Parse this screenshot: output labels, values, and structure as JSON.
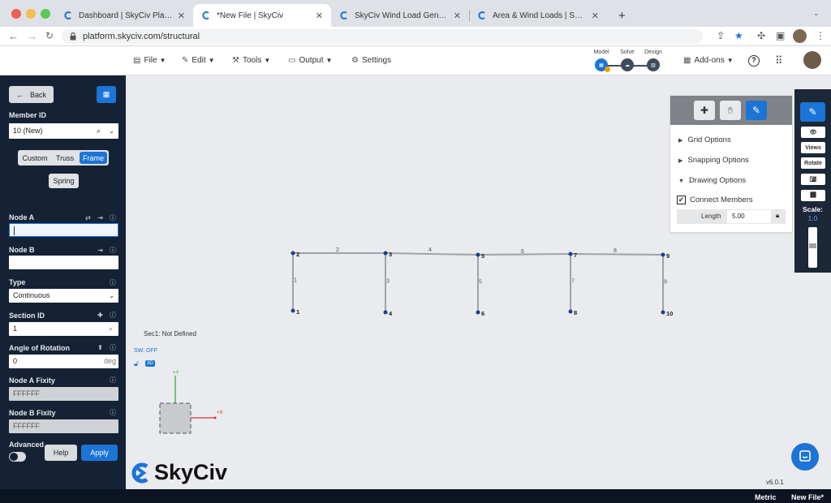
{
  "browser": {
    "tabs": [
      {
        "title": "Dashboard | SkyCiv Platform",
        "active": false
      },
      {
        "title": "*New File | SkyCiv",
        "active": true
      },
      {
        "title": "SkyCiv Wind Load Generator |",
        "active": false
      },
      {
        "title": "Area & Wind Loads | SkyCiv En",
        "active": false
      }
    ],
    "new_tab": "+",
    "url": "platform.skyciv.com/structural"
  },
  "menu": {
    "file": "File",
    "edit": "Edit",
    "tools": "Tools",
    "output": "Output",
    "settings": "Settings",
    "steps": [
      "Model",
      "Solve",
      "Design"
    ],
    "addons": "Add-ons"
  },
  "sidebar": {
    "back": "Back",
    "member_id_label": "Member ID",
    "member_id_value": "10 (New)",
    "types": [
      "Custom",
      "Truss",
      "Frame"
    ],
    "active_type": "Frame",
    "spring": "Spring",
    "node_a_label": "Node A",
    "node_a_value": "",
    "node_b_label": "Node B",
    "node_b_value": "",
    "type_label": "Type",
    "type_value": "Continuous",
    "section_label": "Section ID",
    "section_value": "1",
    "rotation_label": "Angle of Rotation",
    "rotation_value": "0",
    "rotation_unit": "deg",
    "fixity_a_label": "Node A Fixity",
    "fixity_a_value": "FFFFFF",
    "fixity_b_label": "Node B Fixity",
    "fixity_b_value": "FFFFFF",
    "advanced": "Advanced",
    "help": "Help",
    "apply": "Apply"
  },
  "canvas": {
    "sec_label": "Sec1: Not Defined",
    "sw": "SW: OFF",
    "badge": "3D",
    "axis_y": "+Y",
    "axis_x": "+X",
    "logo": "SkyCiv",
    "version": "v6.0.1",
    "nodes": [
      {
        "id": "1"
      },
      {
        "id": "2"
      },
      {
        "id": "3"
      },
      {
        "id": "4"
      },
      {
        "id": "5"
      },
      {
        "id": "6"
      },
      {
        "id": "7"
      },
      {
        "id": "8"
      },
      {
        "id": "9"
      },
      {
        "id": "10"
      }
    ],
    "members": [
      {
        "id": "1",
        "from": "1",
        "to": "2"
      },
      {
        "id": "2",
        "from": "2",
        "to": "3"
      },
      {
        "id": "3",
        "from": "4",
        "to": "3"
      },
      {
        "id": "4",
        "from": "3",
        "to": "5"
      },
      {
        "id": "5",
        "from": "6",
        "to": "5"
      },
      {
        "id": "6",
        "from": "5",
        "to": "7"
      },
      {
        "id": "7",
        "from": "8",
        "to": "7"
      },
      {
        "id": "8",
        "from": "7",
        "to": "9"
      },
      {
        "id": "9",
        "from": "10",
        "to": "9"
      }
    ]
  },
  "options_panel": {
    "grid": "Grid Options",
    "snapping": "Snapping Options",
    "drawing": "Drawing Options",
    "connect": "Connect Members",
    "length_label": "Length",
    "length_value": "5.00"
  },
  "right_toolbar": {
    "views": "Views",
    "rotate": "Rotate",
    "scale_label": "Scale:",
    "scale_value": "1.0"
  },
  "status": {
    "units": "Metric",
    "file": "New File*"
  },
  "colors": {
    "sidebar_bg": "#152235",
    "accent": "#1b74d6",
    "member": "#9ca3ab",
    "node": "#1f3c8f"
  }
}
